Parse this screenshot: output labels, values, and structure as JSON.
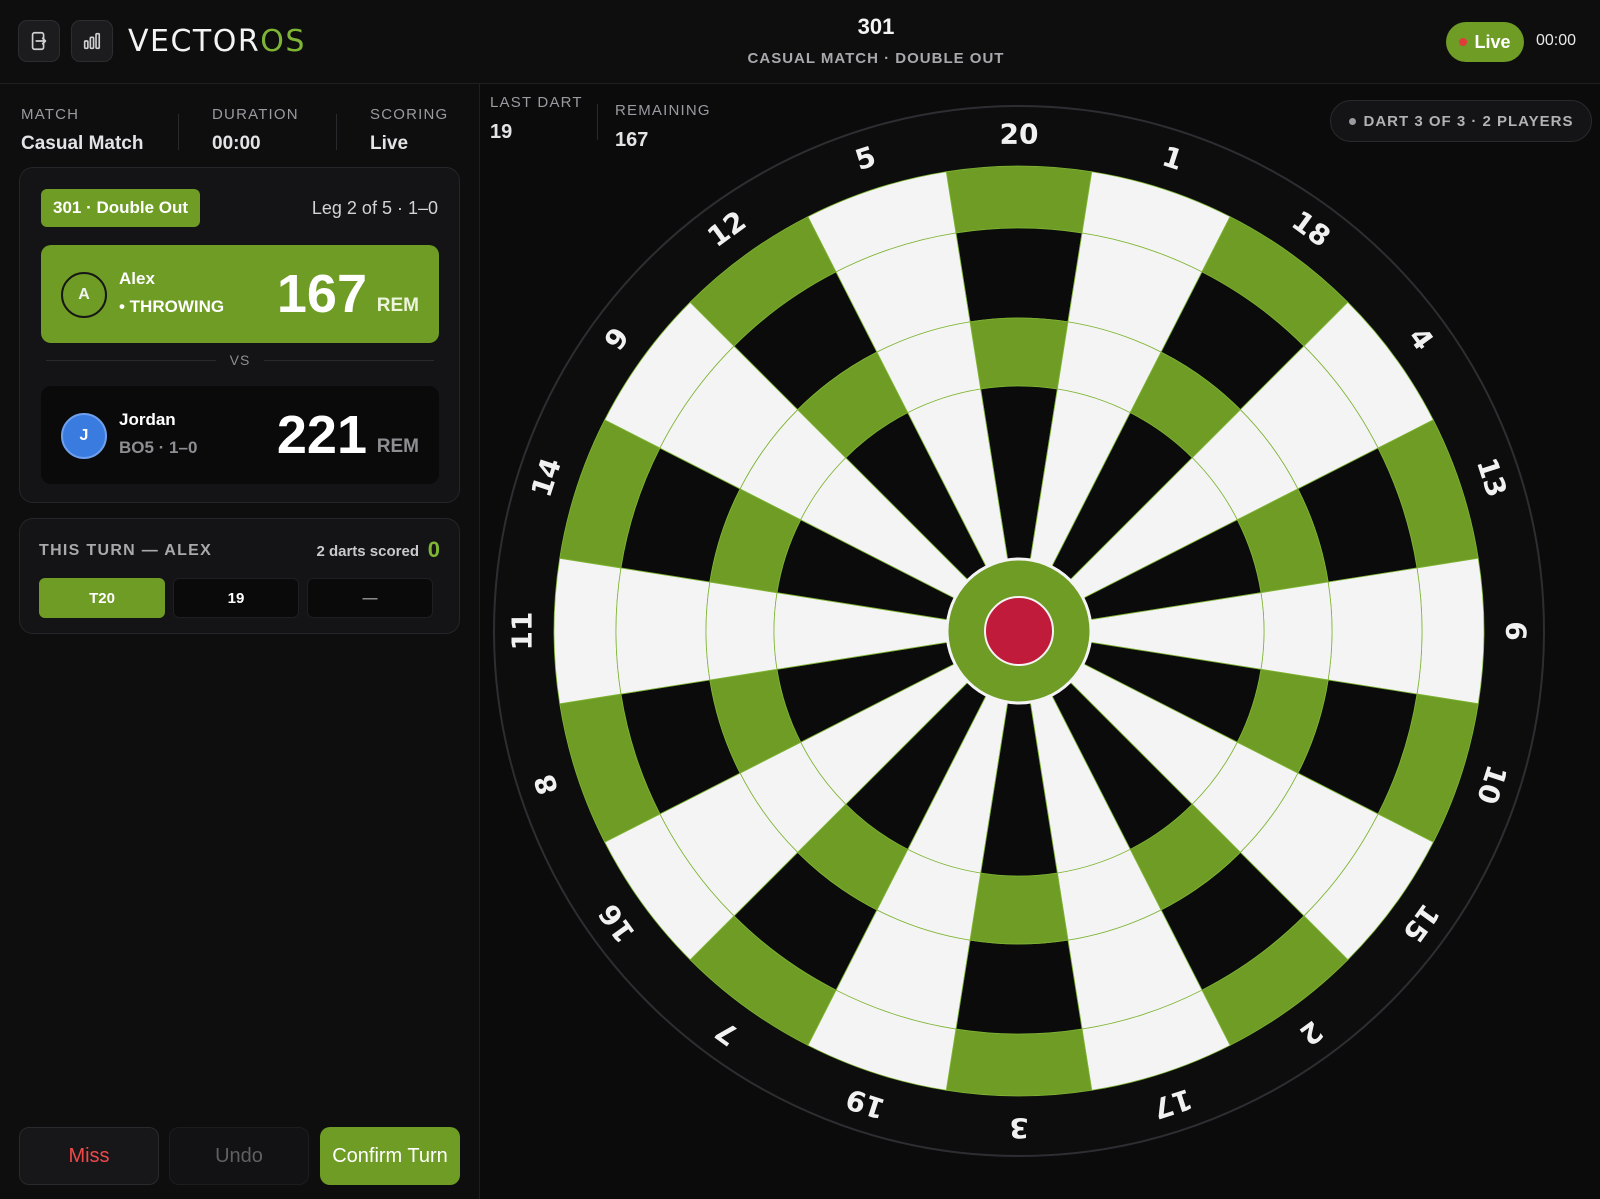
{
  "app": {
    "logo_main": "VECTOR",
    "logo_accent": "OS",
    "title": "301",
    "subtitle": "CASUAL MATCH · DOUBLE OUT",
    "live_label": "Live",
    "clock": "00:00",
    "accent_color": "#6e9c24",
    "icons": {
      "exit": "exit-icon",
      "stats": "bar-chart-icon"
    }
  },
  "match_info": {
    "match_label": "MATCH",
    "match_value": "Casual Match",
    "duration_label": "DURATION",
    "duration_value": "00:00",
    "scoring_label": "SCORING",
    "scoring_value": "Live"
  },
  "scoreboard": {
    "format": "301 · Double Out",
    "leg_info": "Leg 2 of 5 · 1–0",
    "vs_label": "VS",
    "players": [
      {
        "initial": "A",
        "name": "Alex",
        "status": "• THROWING",
        "score": "167",
        "unit": "REM",
        "active": true
      },
      {
        "initial": "J",
        "name": "Jordan",
        "status": "BO5 · 1–0",
        "score": "221",
        "unit": "REM",
        "active": false
      }
    ]
  },
  "turn": {
    "title": "THIS TURN — ALEX",
    "scored_label": "2 darts scored",
    "total": "0",
    "darts": [
      "T20",
      "19",
      "—"
    ]
  },
  "actions": {
    "miss": "Miss",
    "undo": "Undo",
    "confirm": "Confirm Turn"
  },
  "board_header": {
    "last_dart_label": "LAST DART",
    "last_dart_value": "19",
    "remaining_label": "REMAINING",
    "remaining_value": "167",
    "dart_status": "DART 3 OF 3 · 2 PLAYERS"
  },
  "dartboard": {
    "numbers": [
      20,
      1,
      18,
      4,
      13,
      6,
      10,
      15,
      2,
      17,
      3,
      19,
      7,
      16,
      8,
      11,
      14,
      9,
      12,
      5
    ],
    "colors": {
      "dark": "#0b0b0c",
      "light": "#f4f4f4",
      "ring": "#6e9c24",
      "bull": "#c01b3b"
    }
  }
}
